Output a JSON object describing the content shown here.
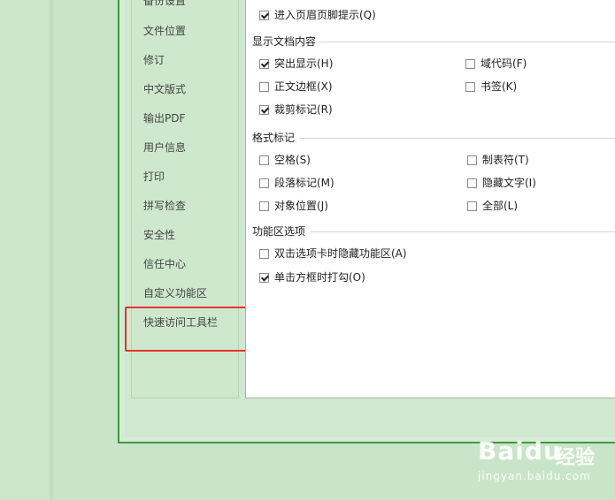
{
  "sidebar": {
    "items": [
      {
        "label": "备份设置"
      },
      {
        "label": "文件位置"
      },
      {
        "label": "修订"
      },
      {
        "label": "中文版式"
      },
      {
        "label": "输出PDF"
      },
      {
        "label": "用户信息"
      },
      {
        "label": "打印"
      },
      {
        "label": "拼写检查"
      },
      {
        "label": "安全性"
      },
      {
        "label": "信任中心"
      },
      {
        "label": "自定义功能区"
      },
      {
        "label": "快速访问工具栏"
      }
    ]
  },
  "panel": {
    "top_option": {
      "label": "进入页眉页脚提示(Q)",
      "checked": true
    },
    "sections": {
      "display": {
        "title": "显示文档内容",
        "options": [
          {
            "label": "突出显示(H)",
            "checked": true
          },
          {
            "label": "域代码(F)",
            "checked": false
          },
          {
            "label": "正文边框(X)",
            "checked": false
          },
          {
            "label": "书签(K)",
            "checked": false
          },
          {
            "label": "裁剪标记(R)",
            "checked": true
          }
        ]
      },
      "format": {
        "title": "格式标记",
        "options": [
          {
            "label": "空格(S)",
            "checked": false
          },
          {
            "label": "制表符(T)",
            "checked": false
          },
          {
            "label": "段落标记(M)",
            "checked": false
          },
          {
            "label": "隐藏文字(I)",
            "checked": false
          },
          {
            "label": "对象位置(J)",
            "checked": false
          },
          {
            "label": "全部(L)",
            "checked": false
          }
        ]
      },
      "ribbon": {
        "title": "功能区选项",
        "options": [
          {
            "label": "双击选项卡时隐藏功能区(A)",
            "checked": false
          },
          {
            "label": "单击方框时打勾(O)",
            "checked": true
          }
        ]
      }
    }
  },
  "watermark": {
    "logo": "Bai",
    "logo_suffix": "du",
    "cn_text": "经验",
    "url": "jingyan.baidu.com"
  },
  "colors": {
    "background": "#c9e5c9",
    "highlight": "#e8332c",
    "frame": "#3f9a3f"
  }
}
